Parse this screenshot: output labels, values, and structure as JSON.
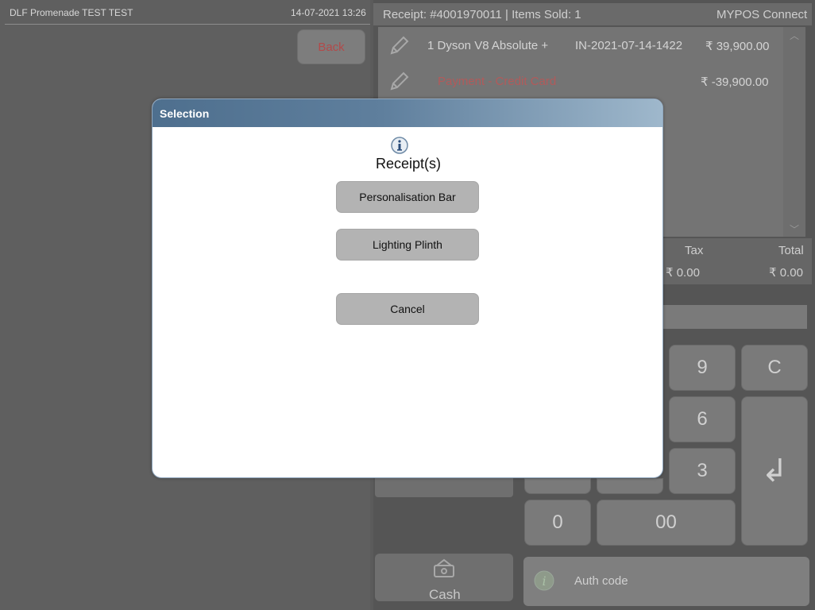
{
  "header": {
    "store_name": "DLF Promenade TEST TEST",
    "datetime": "14-07-2021 13:26",
    "back_label": "Back"
  },
  "receipt": {
    "title": "Receipt: #4001970011 | Items Sold: 1",
    "brand": "MYPOS Connect",
    "lines": [
      {
        "desc": "1 Dyson V8 Absolute +",
        "code": "IN-2021-07-14-1422",
        "amount": "₹ 39,900.00"
      },
      {
        "desc": "Payment - Credit Card",
        "code": "",
        "amount": "₹ -39,900.00"
      }
    ],
    "totals": {
      "tax_label": "Tax",
      "tax_value": "₹ 0.00",
      "total_label": "Total",
      "total_value": "₹ 0.00"
    }
  },
  "keypad": {
    "k9": "9",
    "kC": "C",
    "k6": "6",
    "k3": "3",
    "k0": "0",
    "k00": "00",
    "enter": "↲"
  },
  "bottom": {
    "cash_label": "Cash",
    "auth_placeholder": "Auth code"
  },
  "modal": {
    "title": "Selection",
    "heading": "Receipt(s)",
    "options": [
      "Personalisation Bar",
      "Lighting Plinth"
    ],
    "cancel_label": "Cancel"
  },
  "colors": {
    "modal_title_gradient_start": "#4e6f8e",
    "modal_title_gradient_end": "#9fb8cc",
    "payment_text": "#b25a5a"
  }
}
